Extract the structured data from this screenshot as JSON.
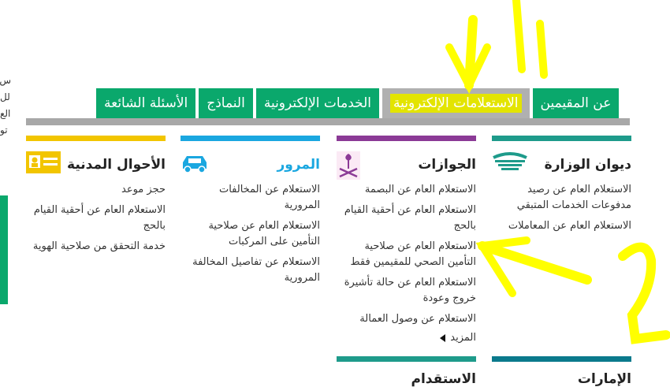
{
  "left_strip": {
    "lines": [
      "س",
      "لل",
      "الع",
      "تو"
    ]
  },
  "nav": {
    "tabs": [
      {
        "label": "الأسئلة الشائعة",
        "active": false
      },
      {
        "label": "النماذج",
        "active": false
      },
      {
        "label": "الخدمات الإلكترونية",
        "active": false
      },
      {
        "label": "الاستعلامات الإلكترونية",
        "active": true
      },
      {
        "label": "عن المقيمين",
        "active": false
      }
    ]
  },
  "columns": [
    {
      "title": "ديوان الوزارة",
      "bar_color": "#1e9b8b",
      "icon": "ministry-emblem-icon",
      "items": [
        "الاستعلام العام عن رصيد مدفوعات الخدمات المتبقي",
        "الاستعلام العام عن المعاملات"
      ]
    },
    {
      "title": "الجوازات",
      "bar_color": "#8b3a96",
      "icon": "passports-emblem-icon",
      "items": [
        "الاستعلام العام عن البصمة",
        "الاستعلام العام عن أحقية القيام بالحج",
        "الاستعلام العام عن صلاحية التأمين الصحي للمقيمين فقط",
        "الاستعلام العام عن حالة تأشيرة خروج وعودة",
        "الاستعلام عن وصول العمالة"
      ],
      "more": "المزيد"
    },
    {
      "title": "المرور",
      "bar_color": "#1aa7e0",
      "icon": "car-icon",
      "items": [
        "الاستعلام عن المخالفات المرورية",
        "الاستعلام العام عن صلاحية التأمين على المركبات",
        "الاستعلام عن تفاصيل المخالفة المرورية"
      ]
    },
    {
      "title": "الأحوال المدنية",
      "bar_color": "#f2c500",
      "icon": "id-card-icon",
      "items": [
        "حجز موعد",
        "الاستعلام العام عن أحقية القيام بالحج",
        "خدمة التحقق من صلاحية الهوية"
      ]
    }
  ],
  "bottom_row": [
    {
      "title": "الإمارات",
      "bar_color": "#0b7a8c"
    },
    {
      "title": "الاستقدام",
      "bar_color": "#1e9b8b"
    }
  ],
  "annotations": {
    "labels": [
      "1",
      "2"
    ],
    "color": "#ffff00"
  }
}
